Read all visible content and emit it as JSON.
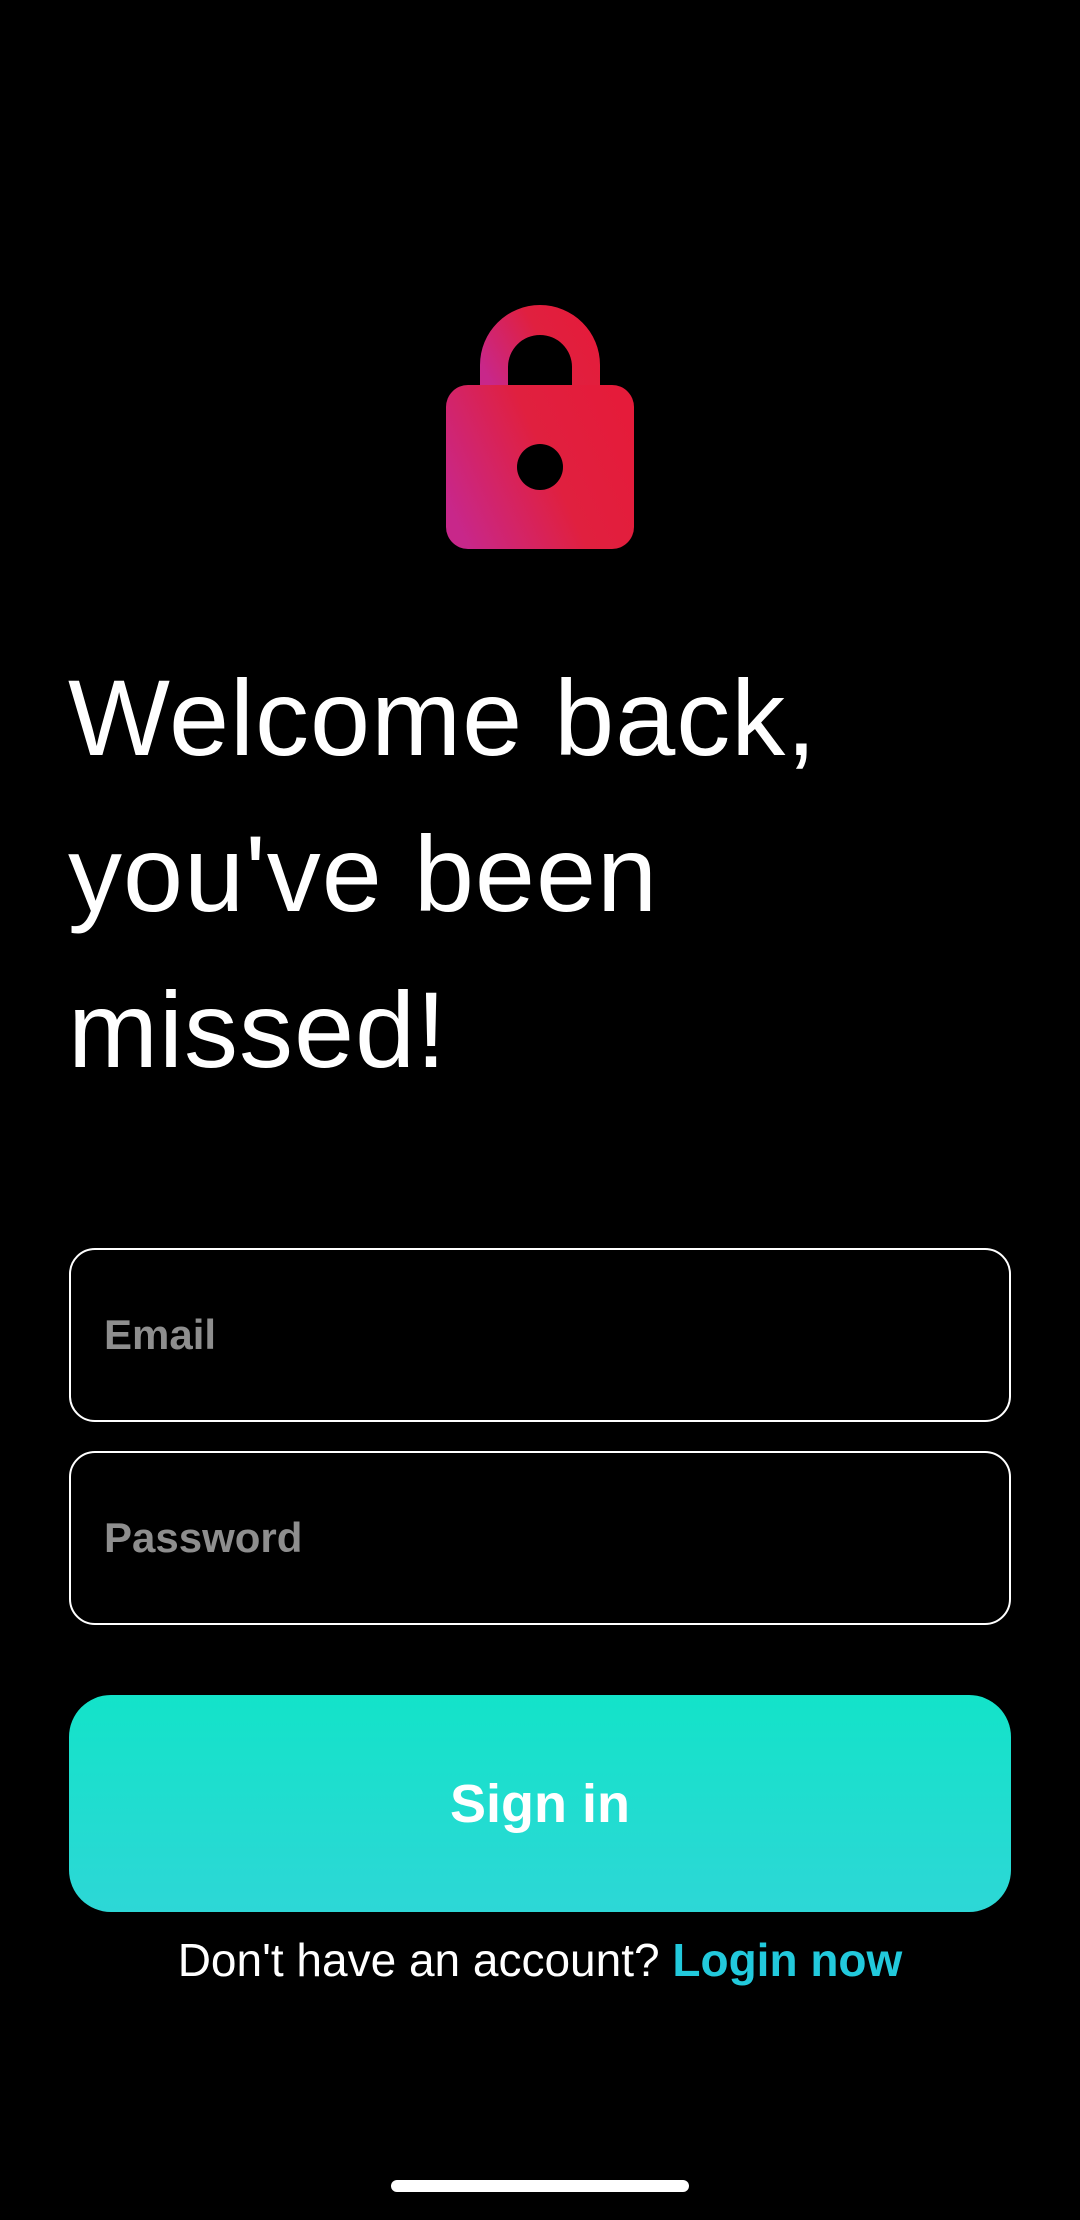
{
  "header": {
    "icon": "lock-icon",
    "title_lines": [
      "Welcome back,",
      "you've been",
      "missed!"
    ]
  },
  "form": {
    "email": {
      "placeholder": "Email",
      "value": ""
    },
    "password": {
      "placeholder": "Password",
      "value": ""
    },
    "signin_label": "Sign in"
  },
  "footer": {
    "prompt": "Don't have an account? ",
    "link_label": "Login now"
  },
  "colors": {
    "background": "#000000",
    "lock_gradient_start": "#c8278a",
    "lock_gradient_end": "#e51b3a",
    "button_gradient_top": "#13e3c9",
    "button_gradient_bottom": "#2dd7d6",
    "link": "#22c9dc",
    "placeholder": "#8e8e8e"
  }
}
